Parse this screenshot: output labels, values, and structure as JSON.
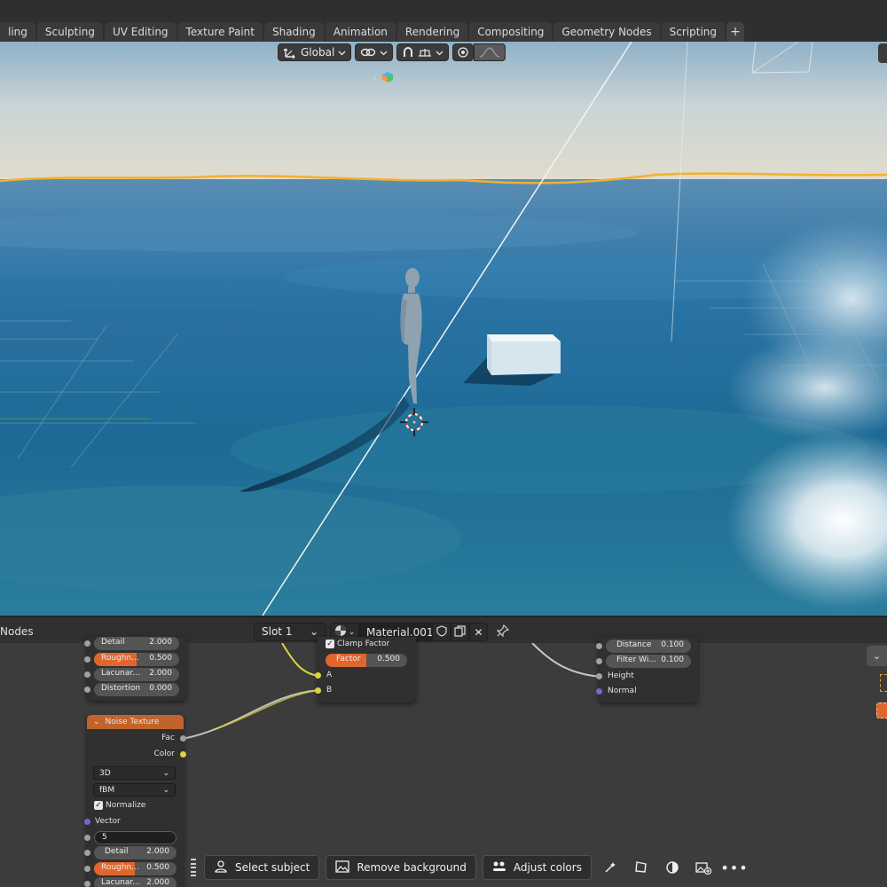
{
  "workspace_tabs": [
    {
      "label": "ling"
    },
    {
      "label": "Sculpting"
    },
    {
      "label": "UV Editing"
    },
    {
      "label": "Texture Paint"
    },
    {
      "label": "Shading"
    },
    {
      "label": "Animation"
    },
    {
      "label": "Rendering"
    },
    {
      "label": "Compositing"
    },
    {
      "label": "Geometry Nodes"
    },
    {
      "label": "Scripting"
    }
  ],
  "add_tab_label": "+",
  "viewport": {
    "orientation_label": "Global",
    "proportional_edit_active": false
  },
  "node_editor": {
    "title": "Nodes",
    "slot": "Slot 1",
    "material": "Material.001",
    "node_top_left": {
      "fields": [
        {
          "label": "Detail",
          "value": "2.000",
          "highlight": false
        },
        {
          "label": "Roughn...",
          "value": "0.500",
          "highlight": true
        },
        {
          "label": "Lacunar...",
          "value": "2.000",
          "highlight": false
        },
        {
          "label": "Distortion",
          "value": "0.000",
          "highlight": false
        }
      ]
    },
    "node_mix": {
      "clamp_label": "Clamp Factor",
      "factor_label": "Factor",
      "factor_value": "0.500",
      "input_a": "A",
      "input_b": "B"
    },
    "node_bump": {
      "distance_label": "Distance",
      "distance_value": "0.100",
      "filter_label": "Filter Wi...",
      "filter_value": "0.100",
      "height_label": "Height",
      "normal_label": "Normal"
    },
    "noise_texture": {
      "title": "Noise Texture",
      "out_fac": "Fac",
      "out_color": "Color",
      "dimensions": "3D",
      "type": "fBM",
      "normalize_label": "Normalize",
      "vector_label": "Vector",
      "scale_input": "5",
      "detail_label": "Detail",
      "detail_value": "2.000",
      "roughness_label": "Roughn...",
      "roughness_value": "0.500",
      "lacunarity_label": "Lacunar...",
      "lacunarity_value": "2.000"
    }
  },
  "overlay_toolbar": {
    "select_subject": "Select subject",
    "remove_background": "Remove background",
    "adjust_colors": "Adjust colors"
  },
  "icons": {
    "orientation": "axis-transform-icon",
    "snap": "link-icon",
    "snap_target": "magnet-icon",
    "proportional": "proportional-edit-icon",
    "falloff": "falloff-curve-icon"
  }
}
